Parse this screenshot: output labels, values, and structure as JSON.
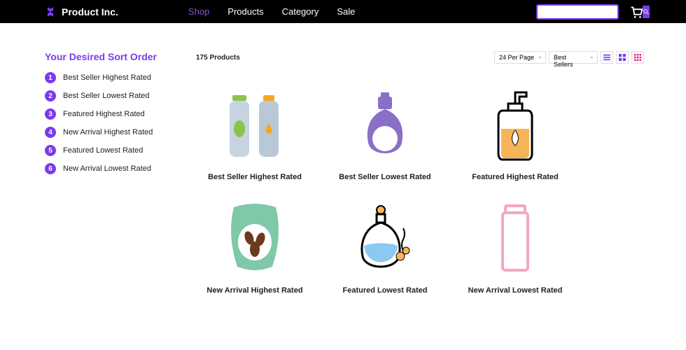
{
  "brand": "Product Inc.",
  "nav": {
    "shop": "Shop",
    "products": "Products",
    "category": "Category",
    "sale": "Sale"
  },
  "search": {
    "placeholder": ""
  },
  "sidebar": {
    "title": "Your Desired Sort Order",
    "items": [
      {
        "n": "1",
        "label": "Best Seller Highest Rated"
      },
      {
        "n": "2",
        "label": "Best Seller Lowest Rated"
      },
      {
        "n": "3",
        "label": "Featured Highest Rated"
      },
      {
        "n": "4",
        "label": "New Arrival Highest Rated"
      },
      {
        "n": "5",
        "label": "Featured Lowest Rated"
      },
      {
        "n": "6",
        "label": "New Arrival Lowest Rated"
      }
    ]
  },
  "toolbar": {
    "count": "175 Products",
    "perpage": "24 Per Page",
    "sortby": "Best Sellers"
  },
  "products": [
    {
      "title": "Best Seller Highest Rated"
    },
    {
      "title": "Best Seller Lowest Rated"
    },
    {
      "title": "Featured Highest Rated"
    },
    {
      "title": "New Arrival Highest Rated"
    },
    {
      "title": "Featured Lowest Rated"
    },
    {
      "title": "New Arrival Lowest Rated"
    }
  ],
  "colors": {
    "accent": "#7c3aed",
    "pink": "#e91e8c"
  }
}
